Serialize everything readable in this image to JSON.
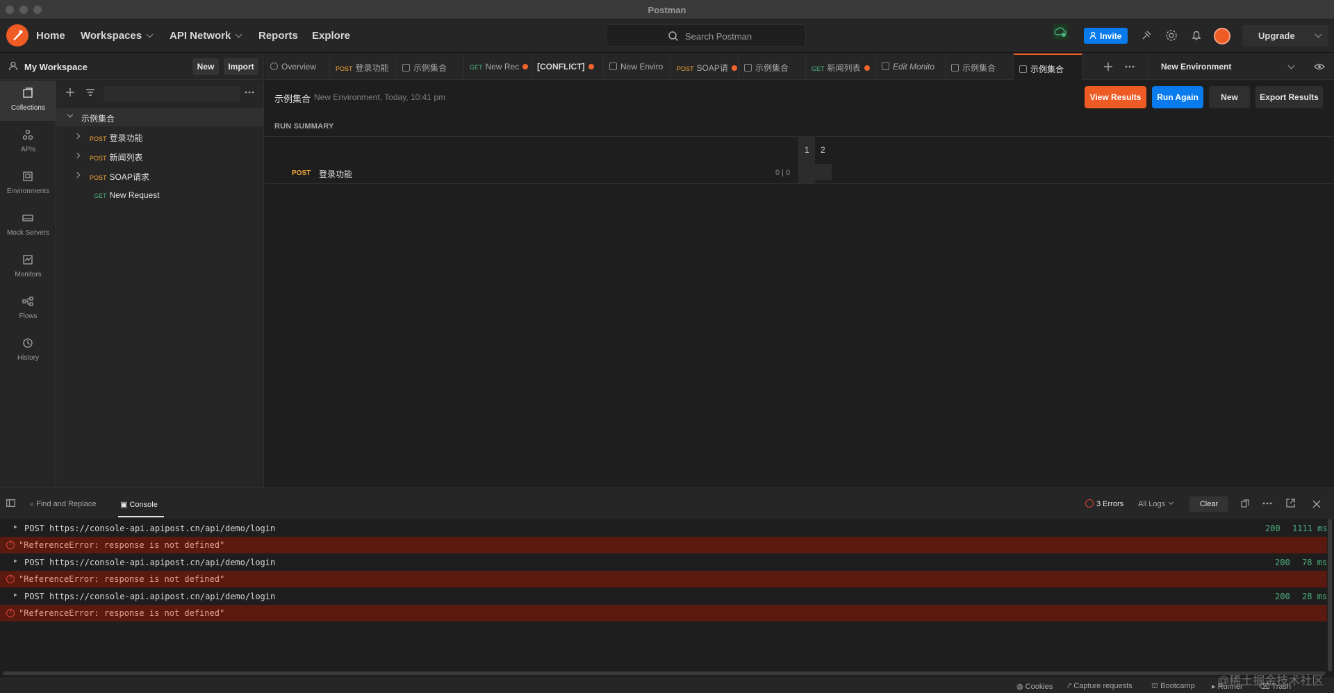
{
  "window": {
    "title": "Postman"
  },
  "header": {
    "nav": [
      "Home",
      "Workspaces",
      "API Network",
      "Reports",
      "Explore"
    ],
    "search_placeholder": "Search Postman",
    "invite_label": "Invite",
    "upgrade_label": "Upgrade"
  },
  "workspace": {
    "name": "My Workspace",
    "new_label": "New",
    "import_label": "Import"
  },
  "tabs": [
    {
      "label": "Overview"
    },
    {
      "method": "POST",
      "label": "登录功能"
    },
    {
      "label": "示例集合"
    },
    {
      "method": "GET",
      "label": "New Rec"
    },
    {
      "label": "[CONFLICT]"
    },
    {
      "label": "New Enviro"
    },
    {
      "method": "POST",
      "label": "SOAP请"
    },
    {
      "label": "示例集合"
    },
    {
      "method": "GET",
      "label": "新闻列表"
    },
    {
      "label": "Edit Monito"
    },
    {
      "label": "示例集合"
    },
    {
      "label": "示例集合"
    }
  ],
  "environment": {
    "selected": "New Environment"
  },
  "rail": [
    "Collections",
    "APIs",
    "Environments",
    "Mock Servers",
    "Monitors",
    "Flows",
    "History"
  ],
  "collection": {
    "name": "示例集合",
    "requests": [
      {
        "method": "POST",
        "name": "登录功能"
      },
      {
        "method": "POST",
        "name": "新闻列表"
      },
      {
        "method": "POST",
        "name": "SOAP请求"
      },
      {
        "method": "GET",
        "name": "New Request"
      }
    ]
  },
  "runner": {
    "title": "示例集合",
    "subtitle": "New Environment, Today, 10:41 pm",
    "view_results": "View Results",
    "run_again": "Run Again",
    "new": "New",
    "export": "Export Results",
    "summary_label": "RUN SUMMARY",
    "iterations": [
      "1",
      "2"
    ],
    "request_method": "POST",
    "request_name": "登录功能",
    "request_count": "0 | 0"
  },
  "console": {
    "find_replace": "Find and Replace",
    "console_label": "Console",
    "errors": "3 Errors",
    "all_logs": "All Logs",
    "clear": "Clear",
    "logs": [
      {
        "type": "req",
        "text": "POST https://console-api.apipost.cn/api/demo/login",
        "status": "200",
        "time": "1111 ms"
      },
      {
        "type": "err",
        "text": "\"ReferenceError: response is not defined\""
      },
      {
        "type": "req",
        "text": "POST https://console-api.apipost.cn/api/demo/login",
        "status": "200",
        "time": "78 ms"
      },
      {
        "type": "err",
        "text": "\"ReferenceError: response is not defined\""
      },
      {
        "type": "req",
        "text": "POST https://console-api.apipost.cn/api/demo/login",
        "status": "200",
        "time": "28 ms"
      },
      {
        "type": "err",
        "text": "\"ReferenceError: response is not defined\""
      }
    ]
  },
  "statusbar": [
    "Cookies",
    "Capture requests",
    "Bootcamp",
    "Runner",
    "Trash"
  ],
  "watermark": "@稀土掘金技术社区",
  "colors": {
    "accent": "#ef5b25",
    "primary": "#097bed",
    "error_bg": "#5a1a0f"
  }
}
